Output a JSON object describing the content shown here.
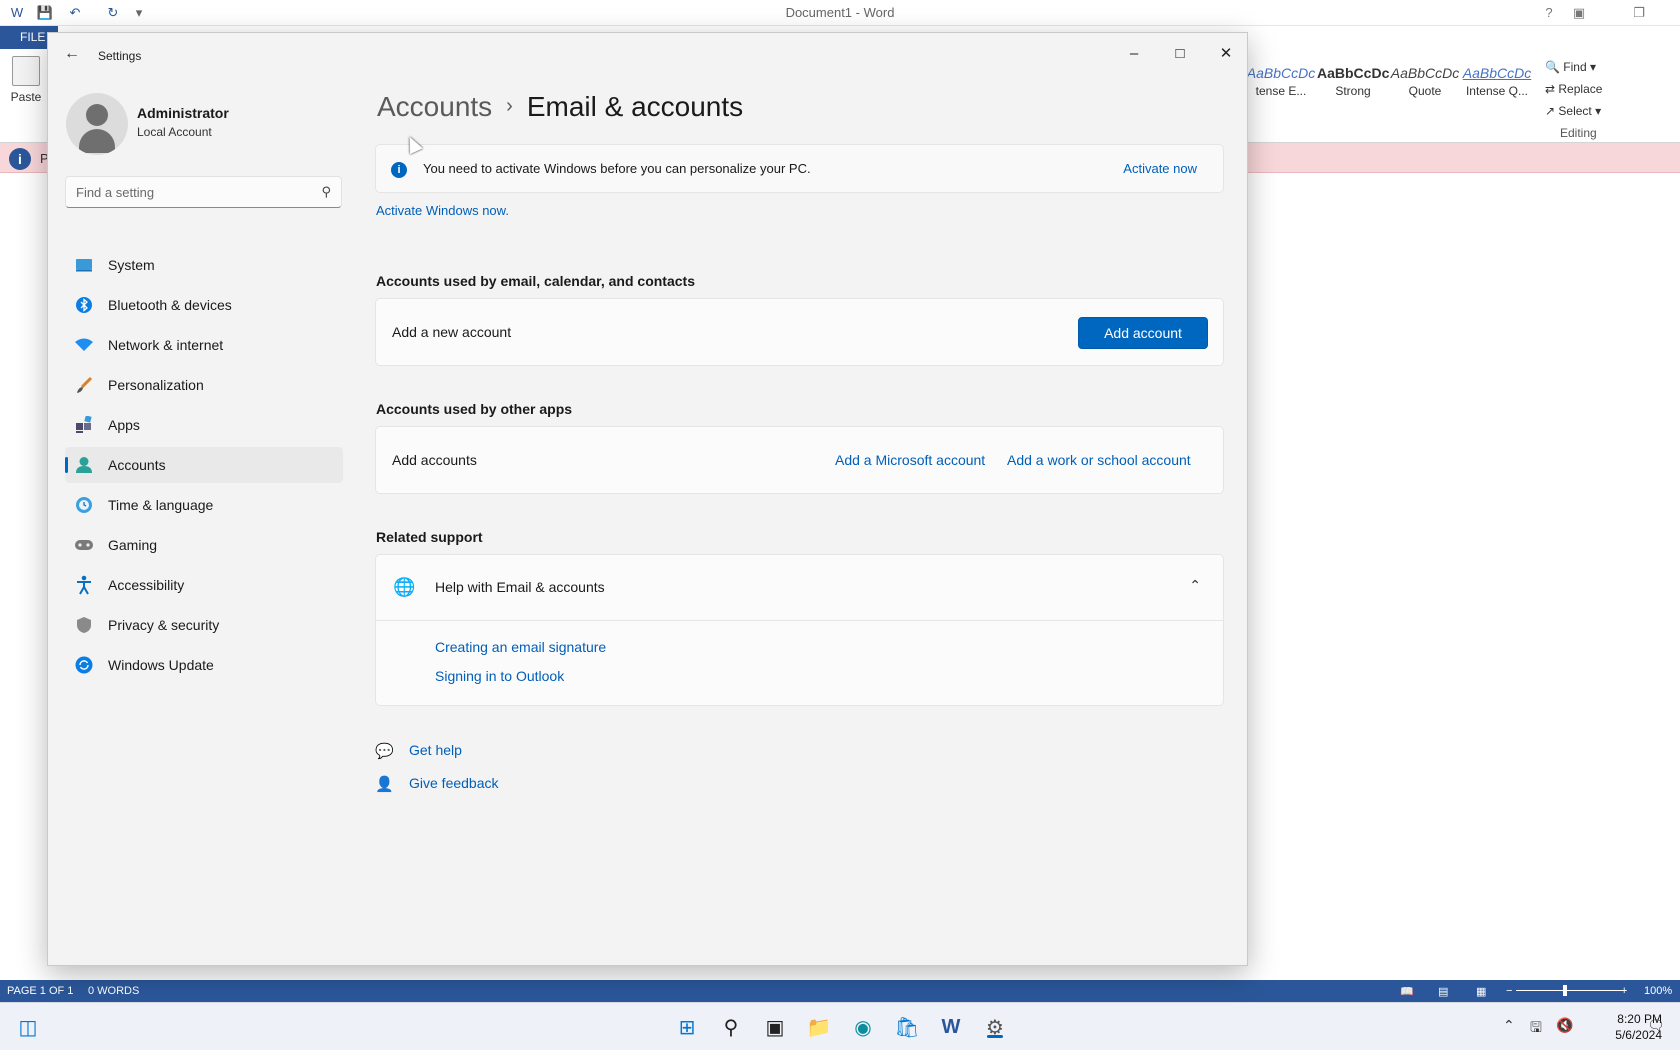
{
  "word": {
    "title": "Document1 - Word",
    "file_tab": "FILE",
    "paste_label": "Paste",
    "styles": [
      {
        "sample": "AaBbCcDc",
        "label": "tense E..."
      },
      {
        "sample": "AaBbCcDc",
        "label": "Strong"
      },
      {
        "sample": "AaBbCcDc",
        "label": "Quote"
      },
      {
        "sample": "AaBbCcDc",
        "label": "Intense Q..."
      }
    ],
    "editing": {
      "find": "Find",
      "replace": "Replace",
      "select": "Select",
      "group_label": "Editing"
    },
    "message_prefix": "P",
    "status": {
      "page": "PAGE 1 OF 1",
      "words": "0 WORDS",
      "zoom": "100%"
    }
  },
  "settings": {
    "app_title": "Settings",
    "user": {
      "name": "Administrator",
      "type": "Local Account"
    },
    "search": {
      "placeholder": "Find a setting"
    },
    "nav": [
      {
        "label": "System",
        "icon": "system-icon"
      },
      {
        "label": "Bluetooth & devices",
        "icon": "bluetooth-icon"
      },
      {
        "label": "Network & internet",
        "icon": "wifi-icon"
      },
      {
        "label": "Personalization",
        "icon": "brush-icon"
      },
      {
        "label": "Apps",
        "icon": "apps-icon"
      },
      {
        "label": "Accounts",
        "icon": "person-icon",
        "active": true
      },
      {
        "label": "Time & language",
        "icon": "clock-globe-icon"
      },
      {
        "label": "Gaming",
        "icon": "gamepad-icon"
      },
      {
        "label": "Accessibility",
        "icon": "accessibility-icon"
      },
      {
        "label": "Privacy & security",
        "icon": "shield-icon"
      },
      {
        "label": "Windows Update",
        "icon": "update-icon"
      }
    ],
    "breadcrumb": {
      "parent": "Accounts",
      "separator": "›",
      "current": "Email & accounts"
    },
    "activation": {
      "message": "You need to activate Windows before you can personalize your PC.",
      "action": "Activate now",
      "link": "Activate Windows now."
    },
    "email_section": {
      "heading": "Accounts used by email, calendar, and contacts",
      "row_label": "Add a new account",
      "button": "Add account"
    },
    "other_apps_section": {
      "heading": "Accounts used by other apps",
      "row_label": "Add accounts",
      "link_microsoft": "Add a Microsoft account",
      "link_work": "Add a work or school account"
    },
    "related_support": {
      "heading": "Related support",
      "help_title": "Help with Email & accounts",
      "links": [
        "Creating an email signature",
        "Signing in to Outlook"
      ]
    },
    "footer": {
      "get_help": "Get help",
      "give_feedback": "Give feedback"
    }
  },
  "taskbar": {
    "time": "8:20 PM",
    "date": "5/6/2024"
  },
  "colors": {
    "accent": "#0067c0",
    "word_blue": "#2b579a",
    "message_bar": "#f8d7da"
  }
}
